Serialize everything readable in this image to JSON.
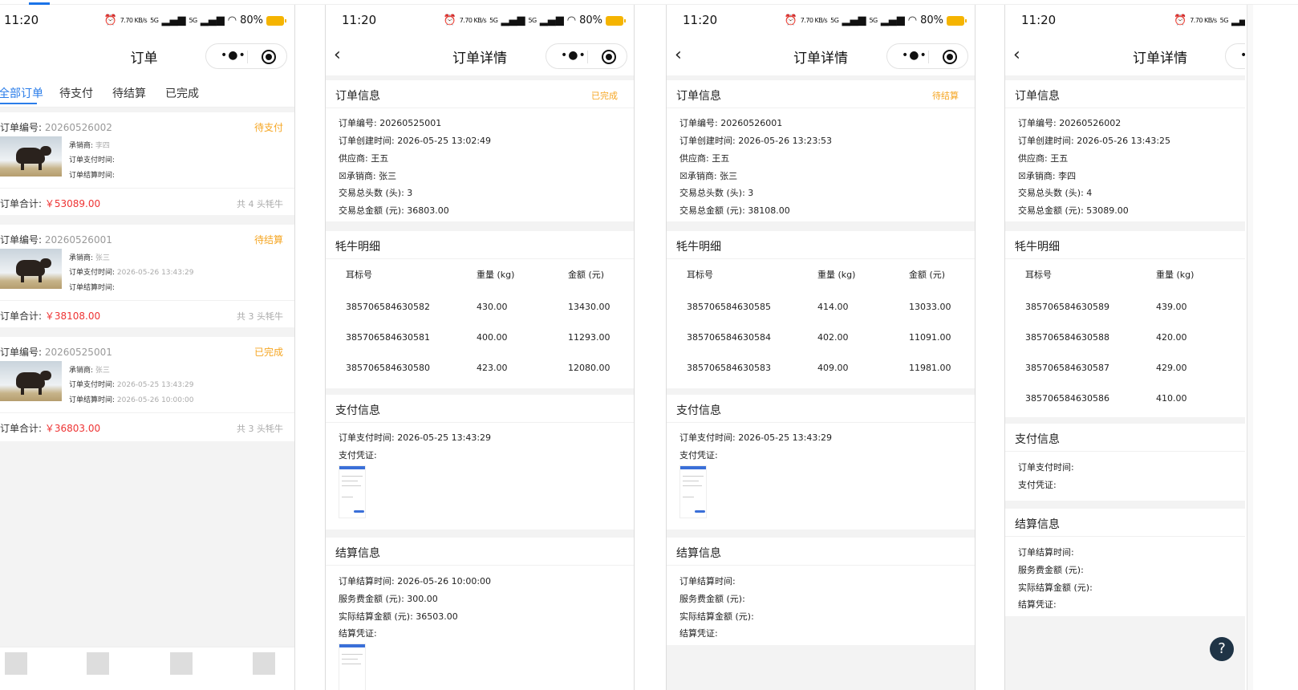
{
  "status_bar": {
    "time": "11:20",
    "speed": "7.70 KB/s",
    "net1": "5G",
    "net2": "5G",
    "battery": "80%"
  },
  "order_list": {
    "title": "订单",
    "tabs": [
      "全部订单",
      "待支付",
      "待结算",
      "已完成"
    ],
    "labels": {
      "order_no": "订单编号: ",
      "seller": "承销商: ",
      "pay_time": "订单支付时间: ",
      "settle_time": "订单结算时间: ",
      "total": "订单合计: "
    },
    "orders": [
      {
        "no": "20260526002",
        "status": "待支付",
        "seller": "李四",
        "pay_time": "",
        "settle_time": "",
        "total": "￥53089.00",
        "count": "共 4 头牦牛"
      },
      {
        "no": "20260526001",
        "status": "待结算",
        "seller": "张三",
        "pay_time": "2026-05-26 13:43:29",
        "settle_time": "",
        "total": "￥38108.00",
        "count": "共 3 头牦牛"
      },
      {
        "no": "20260525001",
        "status": "已完成",
        "seller": "张三",
        "pay_time": "2026-05-25 13:43:29",
        "settle_time": "2026-05-26 10:00:00",
        "total": "￥36803.00",
        "count": "共 3 头牦牛"
      }
    ]
  },
  "detail_labels": {
    "title": "订单详情",
    "order_info": "订单信息",
    "yak_detail": "牦牛明细",
    "pay_info": "支付信息",
    "settle_info": "结算信息",
    "order_no": "订单编号: ",
    "created": "订单创建时间: ",
    "supplier": "供应商: ",
    "seller": "☒承销商: ",
    "heads": "交易总头数 (头): ",
    "amount": "交易总金额 (元): ",
    "col_tag": "耳标号",
    "col_weight": "重量 (kg)",
    "col_money": "金额 (元)",
    "pay_time": "订单支付时间: ",
    "pay_voucher": "支付凭证: ",
    "settle_time": "订单结算时间: ",
    "service_fee": "服务费金额 (元): ",
    "actual": "实际结算金额 (元): ",
    "settle_voucher": "结算凭证: "
  },
  "details": [
    {
      "status": "已完成",
      "order_no": "20260525001",
      "created": "2026-05-25 13:02:49",
      "supplier": "王五",
      "seller": "张三",
      "heads": "3",
      "amount": "36803.00",
      "yaks": [
        {
          "tag": "385706584630582",
          "weight": "430.00",
          "money": "13430.00"
        },
        {
          "tag": "385706584630581",
          "weight": "400.00",
          "money": "11293.00"
        },
        {
          "tag": "385706584630580",
          "weight": "423.00",
          "money": "12080.00"
        }
      ],
      "pay_time": "2026-05-25 13:43:29",
      "settle_time": "2026-05-26 10:00:00",
      "service_fee": "300.00",
      "actual": "36503.00"
    },
    {
      "status": "待结算",
      "order_no": "20260526001",
      "created": "2026-05-26 13:23:53",
      "supplier": "王五",
      "seller": "张三",
      "heads": "3",
      "amount": "38108.00",
      "yaks": [
        {
          "tag": "385706584630585",
          "weight": "414.00",
          "money": "13033.00"
        },
        {
          "tag": "385706584630584",
          "weight": "402.00",
          "money": "11091.00"
        },
        {
          "tag": "385706584630583",
          "weight": "409.00",
          "money": "11981.00"
        }
      ],
      "pay_time": "2026-05-25 13:43:29",
      "settle_time": "",
      "service_fee": "",
      "actual": ""
    },
    {
      "status": "",
      "order_no": "20260526002",
      "created": "2026-05-26 13:43:25",
      "supplier": "王五",
      "seller": "李四",
      "heads": "4",
      "amount": "53089.00",
      "yaks": [
        {
          "tag": "385706584630589",
          "weight": "439.00"
        },
        {
          "tag": "385706584630588",
          "weight": "420.00"
        },
        {
          "tag": "385706584630587",
          "weight": "429.00"
        },
        {
          "tag": "385706584630586",
          "weight": "410.00"
        }
      ],
      "pay_time": "",
      "settle_time": "",
      "service_fee": "",
      "actual": ""
    }
  ],
  "help": "?",
  "colors": {
    "accent": "#2b7de9",
    "pending": "#f5a623",
    "price": "#e33333"
  }
}
